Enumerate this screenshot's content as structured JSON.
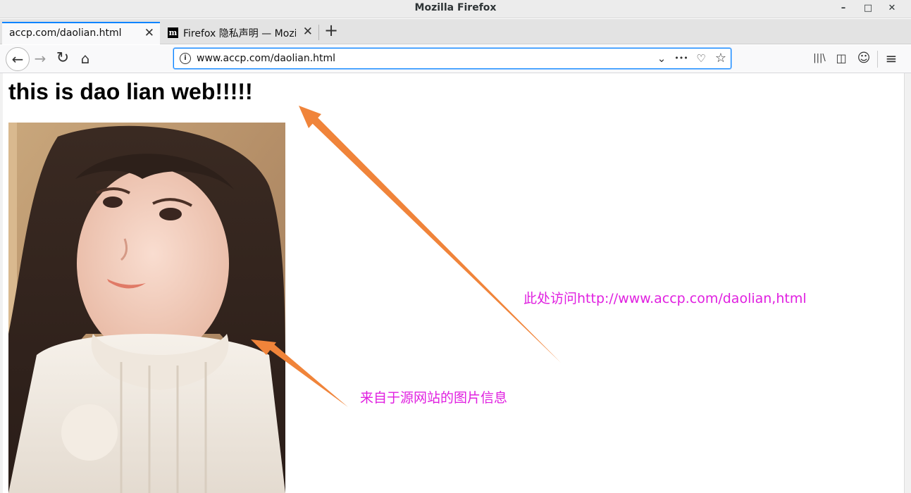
{
  "window": {
    "title": "Mozilla Firefox",
    "controls": {
      "minimize": "–",
      "maximize": "□",
      "close": "✕"
    }
  },
  "tabs": [
    {
      "label": "accp.com/daolian.html",
      "active": true,
      "close": "✕"
    },
    {
      "label": "Firefox 隐私声明 — Mozilla",
      "active": false,
      "close": "✕",
      "favicon": "m"
    }
  ],
  "new_tab": "+",
  "navbar": {
    "back": "←",
    "forward": "→",
    "reload": "↻",
    "home": "⌂",
    "url": "www.accp.com/daolian.html",
    "info": "i",
    "dropdown": "⌄",
    "more": "•••",
    "pocket": "♡",
    "bookmark": "☆",
    "library": "|||\\",
    "sidebar": "◫",
    "account": "☺",
    "menu": "≡"
  },
  "page": {
    "heading": "this is dao lian web!!!!!",
    "annotations": [
      "此处访问http://www.accp.com/daolian,html",
      "来自于源网站的图片信息"
    ]
  },
  "colors": {
    "annotation": "#e020e0",
    "arrow": "#f0843a",
    "accent": "#0a84ff"
  }
}
